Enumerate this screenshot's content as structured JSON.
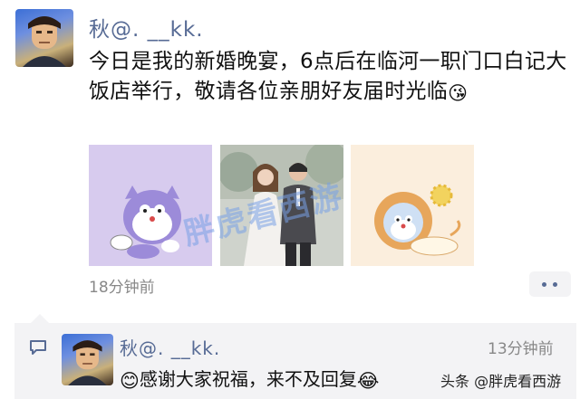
{
  "post": {
    "author": "秋@. __kk.",
    "text": "今日是我的新婚晚宴，6点后在临河一职门口白记大饭店举行，敬请各位亲朋好友届时光临",
    "text_emoji": "😘",
    "time": "18分钟前",
    "images": [
      {
        "subject": "purple-doraemon-sticker"
      },
      {
        "subject": "wedding-couple-photo"
      },
      {
        "subject": "lion-doraemon-sticker"
      }
    ],
    "watermark": "胖虎看西游"
  },
  "comment": {
    "author": "秋@. __kk.",
    "time": "13分钟前",
    "text_emoji_lead": "😊",
    "text": "感谢大家祝福，来不及回复",
    "text_emoji_tail": "😂"
  },
  "attribution": "头条 @胖虎看西游",
  "colors": {
    "link_blue": "#576b95",
    "panel_gray": "#f3f3f5",
    "time_gray": "#888888"
  }
}
